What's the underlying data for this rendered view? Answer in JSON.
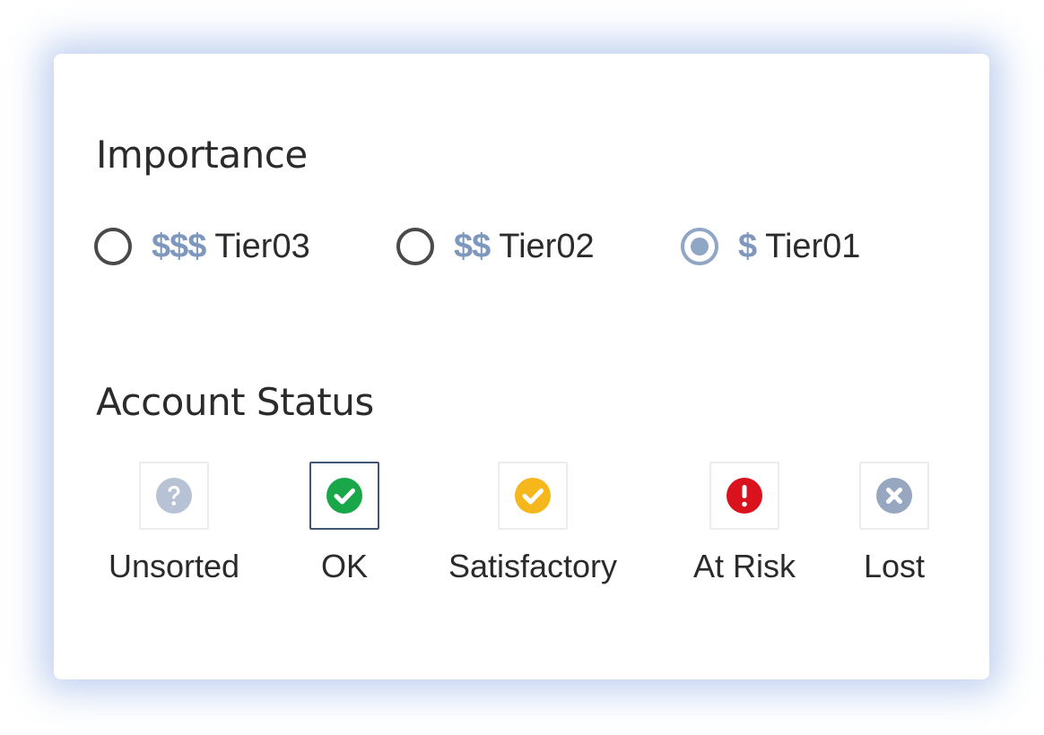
{
  "importance": {
    "title": "Importance",
    "options": [
      {
        "dollars": "$$$",
        "label": "Tier03",
        "checked": false
      },
      {
        "dollars": "$$",
        "label": "Tier02",
        "checked": false
      },
      {
        "dollars": "$",
        "label": "Tier01",
        "checked": true
      }
    ],
    "selected": "Tier01"
  },
  "account_status": {
    "title": "Account Status",
    "selected": "OK",
    "items": [
      {
        "label": "Unsorted",
        "icon": "question-circle-icon",
        "color": "#b7c3d5"
      },
      {
        "label": "OK",
        "icon": "check-circle-icon",
        "color": "#1aa74a"
      },
      {
        "label": "Satisfactory",
        "icon": "check-circle-icon",
        "color": "#f6b71c"
      },
      {
        "label": "At Risk",
        "icon": "exclamation-circle-icon",
        "color": "#d9121d"
      },
      {
        "label": "Lost",
        "icon": "x-circle-icon",
        "color": "#97a7bf"
      }
    ]
  },
  "colors": {
    "radio_checked": "#8fa6c5",
    "dollar_sign": "#7e97bd",
    "selected_border": "#3f5675",
    "panel_glow": "#789be1"
  }
}
